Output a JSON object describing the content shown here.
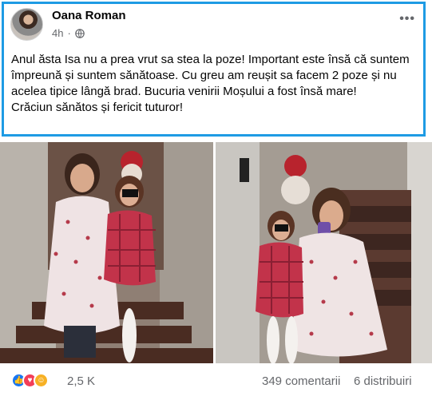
{
  "post": {
    "author": "Oana Roman",
    "time": "4h",
    "separator": "·",
    "more_label": "•••",
    "text_lines": [
      "Anul ăsta Isa nu a prea vrut sa stea la poze! Important este însă că suntem împreună și suntem sănătoase. Cu greu am reușit sa facem 2 poze și nu acelea tipice lângă brad. Bucuria venirii Moșului a fost însă mare!",
      "Crăciun sănătos și fericit tuturor!"
    ]
  },
  "photos": [
    {
      "name": "photo-left"
    },
    {
      "name": "photo-right"
    }
  ],
  "reactions": {
    "icons": [
      "like-icon",
      "love-icon",
      "care-icon"
    ],
    "count": "2,5 K",
    "comments": "349 comentarii",
    "shares": "6 distribuiri"
  },
  "colors": {
    "highlight_border": "#1e9be4",
    "secondary_text": "#65676b",
    "like_blue": "#1877f2",
    "love_red": "#f33e58",
    "care_yellow": "#f7b125"
  }
}
